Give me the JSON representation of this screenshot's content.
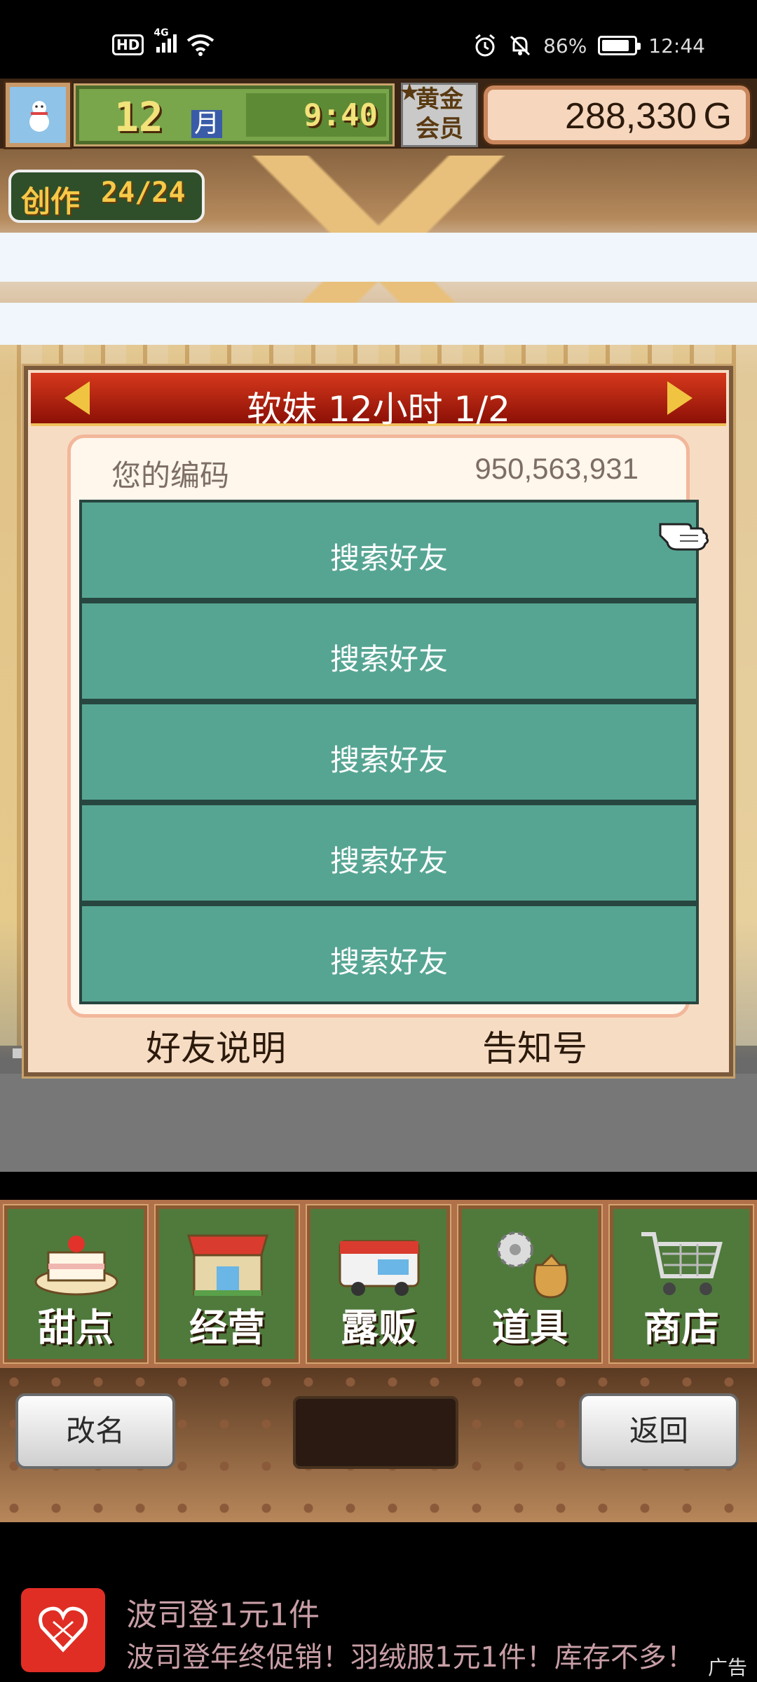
{
  "status_bar": {
    "hd": "HD",
    "network": "4G",
    "battery_text": "86%",
    "battery_level": 0.86,
    "time": "12:44"
  },
  "hud": {
    "month_number": "12",
    "month_unit": "月",
    "time": "9:40",
    "member_line1": "黄金",
    "member_line2": "会员",
    "gold_amount": "288,330",
    "gold_unit": "G",
    "create_label": "创作",
    "create_count": "24/24"
  },
  "dialog": {
    "title": "软妹  12小时 1/2",
    "code_label": "您的编码",
    "code_value": "950,563,931",
    "slots": [
      "搜索好友",
      "搜索好友",
      "搜索好友",
      "搜索好友",
      "搜索好友"
    ],
    "footer_left": "好友说明",
    "footer_right": "告知号"
  },
  "menu": {
    "items": [
      {
        "label": "甜点",
        "icon": "cake-icon"
      },
      {
        "label": "经营",
        "icon": "shop-building-icon"
      },
      {
        "label": "露贩",
        "icon": "food-truck-icon"
      },
      {
        "label": "道具",
        "icon": "gear-bag-icon"
      },
      {
        "label": "商店",
        "icon": "shopping-cart-icon"
      }
    ]
  },
  "controls": {
    "rename": "改名",
    "back": "返回"
  },
  "ad": {
    "title": "波司登1元1件",
    "description": "波司登年终促销！羽绒服1元1件！库存不多！",
    "tag": "广告"
  },
  "colors": {
    "slot_green": "#56a593",
    "header_red": "#c1260f",
    "dialog_bg": "#f7dcc4"
  }
}
